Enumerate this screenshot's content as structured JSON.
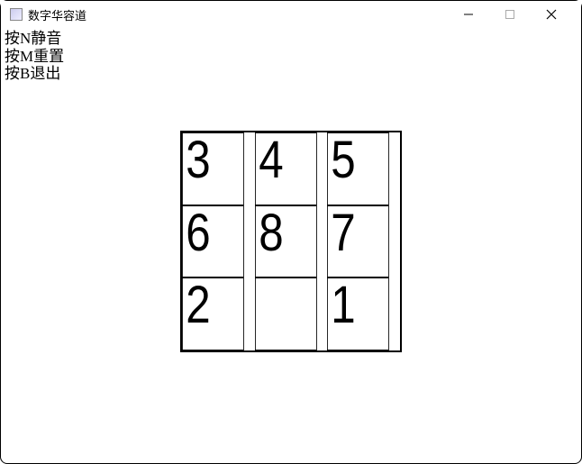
{
  "window": {
    "title": "数字华容道"
  },
  "instructions": {
    "mute": "按N静音",
    "reset": "按M重置",
    "exit": "按B退出"
  },
  "board": {
    "grid_size": 3,
    "tiles": [
      "3",
      "4",
      "5",
      "6",
      "8",
      "7",
      "2",
      "",
      "1"
    ]
  }
}
